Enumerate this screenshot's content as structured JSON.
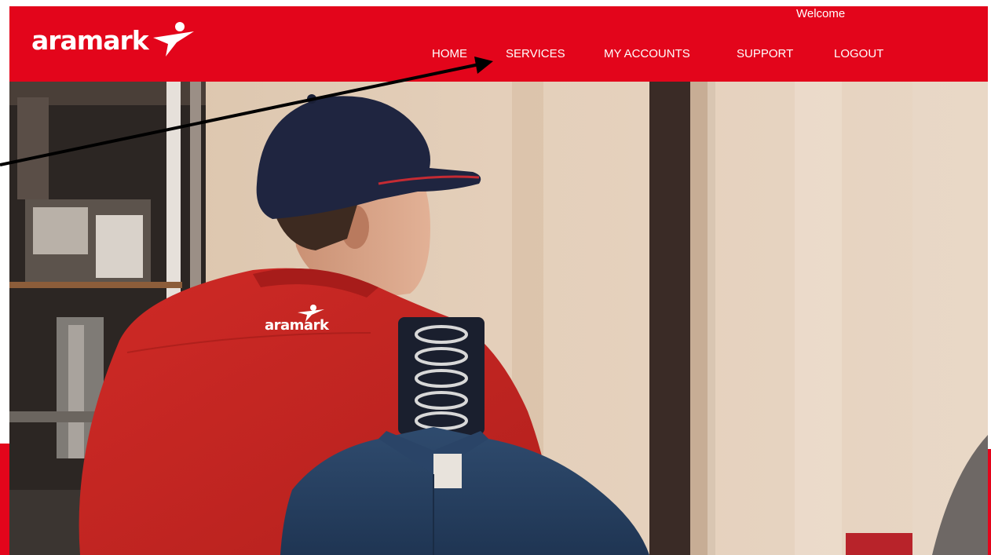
{
  "brand": {
    "logo_text": "aramark",
    "shirt_logo_text": "aramark",
    "primary_color": "#e3051b"
  },
  "header": {
    "welcome": "Welcome"
  },
  "nav": {
    "items": [
      {
        "label": "HOME"
      },
      {
        "label": "SERVICES"
      },
      {
        "label": "MY ACCOUNTS"
      },
      {
        "label": "SUPPORT"
      },
      {
        "label": "LOGOUT"
      }
    ]
  },
  "hero": {
    "icon": "hero-photo-uniform-delivery"
  },
  "annotation": {
    "icon": "arrow-pointer-icon"
  }
}
